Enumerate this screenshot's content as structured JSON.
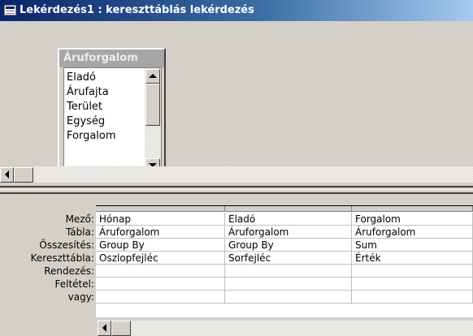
{
  "window": {
    "title": "Lekérdezés1 : kereszttáblás lekérdezés"
  },
  "table_box": {
    "caption": "Áruforgalom",
    "fields": [
      "Eladó",
      "Árufajta",
      "Terület",
      "Egység",
      "Forgalom"
    ]
  },
  "grid": {
    "row_labels": [
      "Mező:",
      "Tábla:",
      "Összesítés:",
      "Kereszttábla:",
      "Rendezés:",
      "Feltétel:",
      "vagy:"
    ],
    "columns": [
      {
        "cells": [
          "Hónap",
          "Áruforgalom",
          "Group By",
          "Oszlopfejléc",
          "",
          "",
          ""
        ]
      },
      {
        "cells": [
          "Eladó",
          "Áruforgalom",
          "Group By",
          "Sorfejléc",
          "",
          "",
          ""
        ]
      },
      {
        "cells": [
          "Forgalom",
          "Áruforgalom",
          "Sum",
          "Érték",
          "",
          "",
          ""
        ]
      }
    ]
  },
  "icons": {
    "app": "query-icon",
    "up": "arrow-up-icon",
    "down": "arrow-down-icon",
    "left": "arrow-left-icon"
  }
}
